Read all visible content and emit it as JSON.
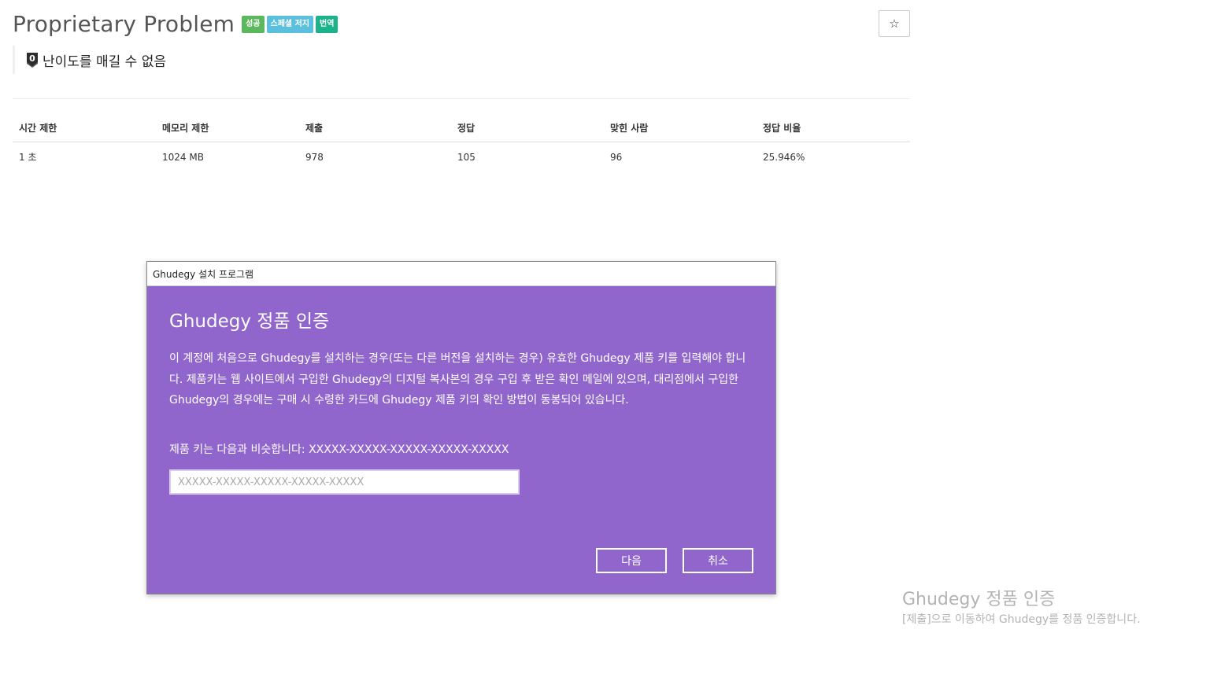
{
  "problem": {
    "title": "Proprietary Problem",
    "badges": [
      {
        "label": "성공",
        "color": "#5cb85c"
      },
      {
        "label": "스페셜 저지",
        "color": "#5bc0de"
      },
      {
        "label": "번역",
        "color": "#1cb38c"
      }
    ],
    "star_icon": "star-outline-icon",
    "star_label": "☆",
    "difficulty_icon": "unrated-tier-icon",
    "difficulty_tier_glyph": "0",
    "difficulty_label": "난이도를 매길 수 없음"
  },
  "stats": {
    "headers": [
      "시간 제한",
      "메모리 제한",
      "제출",
      "정답",
      "맞힌 사람",
      "정답 비율"
    ],
    "rows": [
      [
        "1 초",
        "1024 MB",
        "978",
        "105",
        "96",
        "25.946%"
      ]
    ]
  },
  "dialog": {
    "window_title": "Ghudegy 설치 프로그램",
    "heading": "Ghudegy 정품 인증",
    "body": "이 계정에 처음으로 Ghudegy를 설치하는 경우(또는 다른 버전을 설치하는 경우) 유효한 Ghudegy 제품 키를 입력해야 합니다. 제품키는 웹 사이트에서 구입한 Ghudegy의 디지털 복사본의 경우 구입 후 받은 확인 메일에 있으며, 대리점에서 구입한 Ghudegy의 경우에는 구매 시 수령한 카드에 Ghudegy 제품 키의 확인 방법이 동봉되어 있습니다.",
    "hint": "제품 키는 다음과 비슷합니다: XXXXX-XXXXX-XXXXX-XXXXX-XXXXX",
    "input_value": "",
    "input_placeholder": "XXXXX-XXXXX-XXXXX-XXXXX-XXXXX",
    "next_label": "다음",
    "cancel_label": "취소",
    "background_color": "#9166cc"
  },
  "watermark": {
    "title": "Ghudegy 정품 인증",
    "subtitle": "[제출]으로 이동하여 Ghudegy를 정품 인증합니다."
  }
}
